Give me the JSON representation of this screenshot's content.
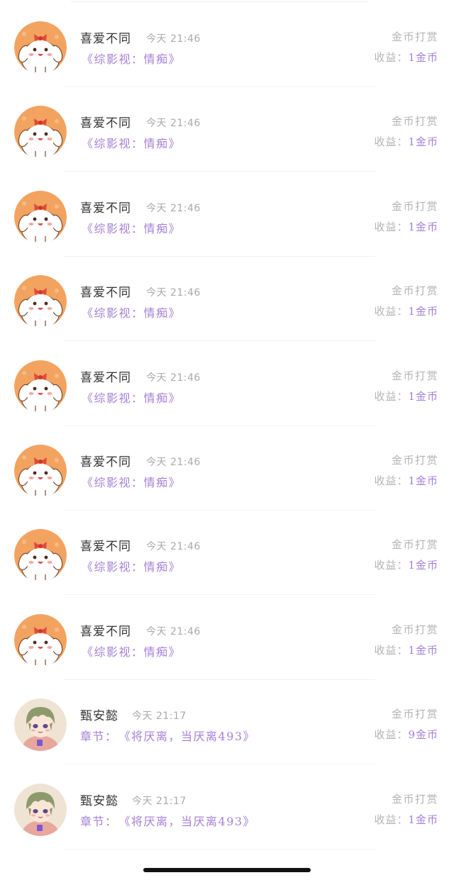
{
  "records": [
    {
      "avatar": "puppy-avatar",
      "name": "喜爱不同",
      "time": "今天 21:46",
      "work_prefix": "",
      "work": "《综影视：情痴》",
      "reward_type": "金币打赏",
      "income_label": "收益：",
      "income_value": "1金币"
    },
    {
      "avatar": "puppy-avatar",
      "name": "喜爱不同",
      "time": "今天 21:46",
      "work_prefix": "",
      "work": "《综影视：情痴》",
      "reward_type": "金币打赏",
      "income_label": "收益：",
      "income_value": "1金币"
    },
    {
      "avatar": "puppy-avatar",
      "name": "喜爱不同",
      "time": "今天 21:46",
      "work_prefix": "",
      "work": "《综影视：情痴》",
      "reward_type": "金币打赏",
      "income_label": "收益：",
      "income_value": "1金币"
    },
    {
      "avatar": "puppy-avatar",
      "name": "喜爱不同",
      "time": "今天 21:46",
      "work_prefix": "",
      "work": "《综影视：情痴》",
      "reward_type": "金币打赏",
      "income_label": "收益：",
      "income_value": "1金币"
    },
    {
      "avatar": "puppy-avatar",
      "name": "喜爱不同",
      "time": "今天 21:46",
      "work_prefix": "",
      "work": "《综影视：情痴》",
      "reward_type": "金币打赏",
      "income_label": "收益：",
      "income_value": "1金币"
    },
    {
      "avatar": "puppy-avatar",
      "name": "喜爱不同",
      "time": "今天 21:46",
      "work_prefix": "",
      "work": "《综影视：情痴》",
      "reward_type": "金币打赏",
      "income_label": "收益：",
      "income_value": "1金币"
    },
    {
      "avatar": "puppy-avatar",
      "name": "喜爱不同",
      "time": "今天 21:46",
      "work_prefix": "",
      "work": "《综影视：情痴》",
      "reward_type": "金币打赏",
      "income_label": "收益：",
      "income_value": "1金币"
    },
    {
      "avatar": "puppy-avatar",
      "name": "喜爱不同",
      "time": "今天 21:46",
      "work_prefix": "",
      "work": "《综影视：情痴》",
      "reward_type": "金币打赏",
      "income_label": "收益：",
      "income_value": "1金币"
    },
    {
      "avatar": "boy-avatar",
      "name": "甄安懿",
      "time": "今天 21:17",
      "work_prefix": "章节：",
      "work": "《将厌离，当厌离493》",
      "reward_type": "金币打赏",
      "income_label": "收益：",
      "income_value": "9金币"
    },
    {
      "avatar": "boy-avatar",
      "name": "甄安懿",
      "time": "今天 21:17",
      "work_prefix": "章节：",
      "work": "《将厌离，当厌离493》",
      "reward_type": "金币打赏",
      "income_label": "收益：",
      "income_value": "1金币"
    }
  ],
  "colors": {
    "accent": "#a57fd6",
    "muted": "#b3b3b3",
    "name": "#333333",
    "puppy_bg": "#f3a360",
    "boy_bg": "#efe3d3"
  }
}
